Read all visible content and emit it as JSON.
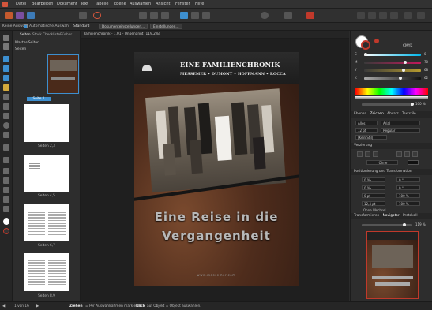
{
  "menu": [
    "Datei",
    "Bearbeiten",
    "Dokument",
    "Text",
    "Tabelle",
    "Ebene",
    "Auswählen",
    "Ansicht",
    "Fenster",
    "Hilfe"
  ],
  "context": {
    "selection": "Keine Auswahl",
    "auto_select": "Automatische Auswahl",
    "auto_value": "Standard",
    "btn_doc": "Dokumenteinstellungen…",
    "btn_prefs": "Einstellungen…"
  },
  "pages_panel": {
    "tabs": [
      "Seiten",
      "Stock",
      "Checkliste",
      "Bücher"
    ],
    "master": "Master-Seiten",
    "pages_header": "Seiten",
    "labels": [
      "Seite 1",
      "Seiten 2,3",
      "Seiten 4,5",
      "Seiten 6,7",
      "Seiten 8,9"
    ]
  },
  "document_tab": "Familienchronik - 1.01 - Unbenannt (119,2%)",
  "cover": {
    "title": "EINE FAMILIENCHRONIK",
    "names": "MESSEMER • DUMONT • HOFFMANN • ROCCA",
    "subtitle_line1": "Eine Reise in die",
    "subtitle_line2": "Vergangenheit",
    "url": "www.messemer.com"
  },
  "right_panel": {
    "color_mode": "CMYK",
    "sliders": [
      {
        "label": "C",
        "value": "0"
      },
      {
        "label": "M",
        "value": "70"
      },
      {
        "label": "Y",
        "value": "68"
      },
      {
        "label": "K",
        "value": "62"
      }
    ],
    "opacity": "100 %",
    "tabs": [
      "Ebenen",
      "Zeichen",
      "Absatz",
      "Textstile"
    ],
    "style": "Alles",
    "font": "Arial",
    "size": "12 pt",
    "weight": "Regular",
    "no_style": "[Kein Stil]",
    "decoration": "Verzierung",
    "none_label": "Ohne",
    "position_section": "Positionierung und Transformation",
    "transform_rows": [
      [
        "0 ‰",
        "0 °"
      ],
      [
        "0 ‰",
        "0 °"
      ],
      [
        "0 pt",
        "100 %"
      ],
      [
        "12,4 pt",
        "100 %"
      ]
    ],
    "no_break": "Ohne Wechsel",
    "bottom_tabs": [
      "Transformieren",
      "Navigator",
      "Protokoll"
    ],
    "zoom": "119 %"
  },
  "status": {
    "page": "1 von 16",
    "hint_bold": "Ziehen",
    "hint": "= Per Auswahlrahmen markieren. ",
    "hint_bold2": "Klick",
    "hint2": "auf Objekt = Objekt auswählen."
  },
  "colors": {
    "accent": "#d3553c",
    "brand_red": "#c0392b"
  }
}
